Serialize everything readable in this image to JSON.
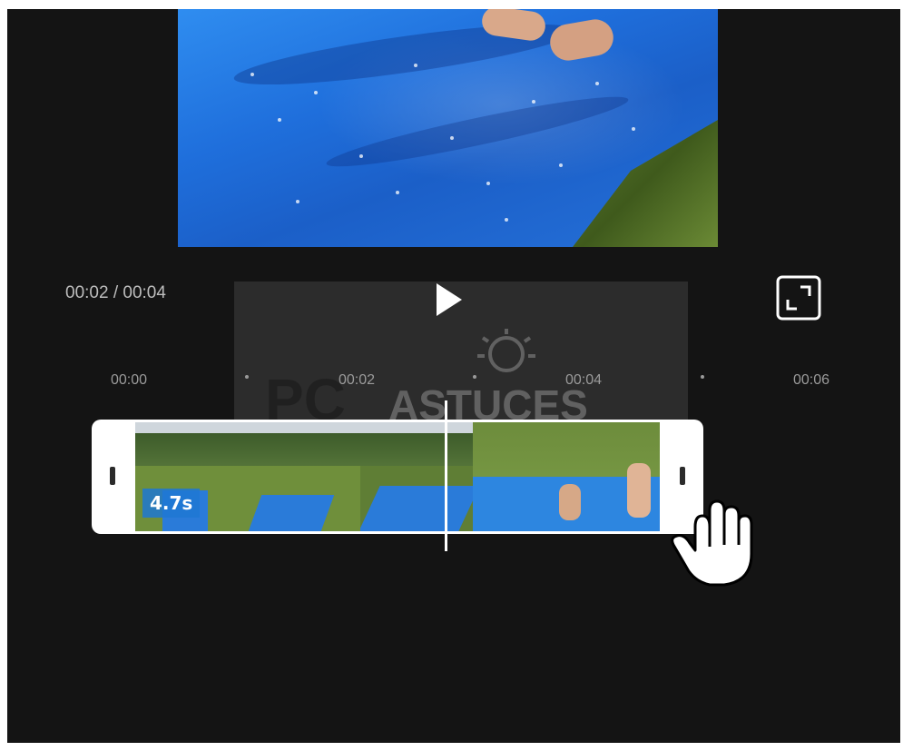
{
  "player": {
    "time_display": "00:02 / 00:04",
    "play_icon": "play-icon",
    "fullscreen_icon": "fullscreen-icon"
  },
  "watermark": {
    "text": "PCASTUCES"
  },
  "ruler": {
    "labels": [
      "00:00",
      "00:02",
      "00:04",
      "00:06"
    ]
  },
  "clip": {
    "duration": "4.7s"
  },
  "colors": {
    "background": "#141414",
    "panel": "#2c2c2c",
    "track": "#ffffff",
    "tarp_blue": "#2a7bd9"
  }
}
